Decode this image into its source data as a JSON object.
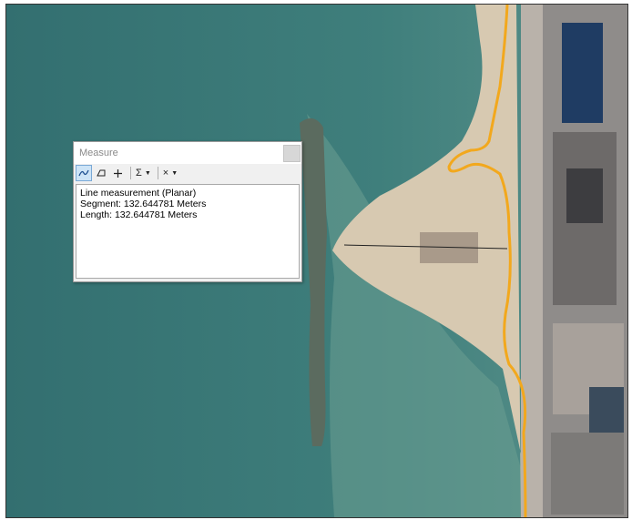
{
  "measure_window": {
    "title": "Measure",
    "toolbar": {
      "line_tool": "line-measure-icon",
      "area_tool": "area-measure-icon",
      "feature_tool": "feature-measure-icon",
      "sum_label": "Σ",
      "units_label": "×"
    },
    "results": {
      "heading": "Line measurement (Planar)",
      "segment": "Segment: 132.644781 Meters",
      "length": "Length: 132.644781 Meters"
    }
  },
  "colors": {
    "sea": "#3f7f7c",
    "sand": "#d7c9b1",
    "shoreline": "#f2a81d",
    "measure_line": "#222222"
  }
}
